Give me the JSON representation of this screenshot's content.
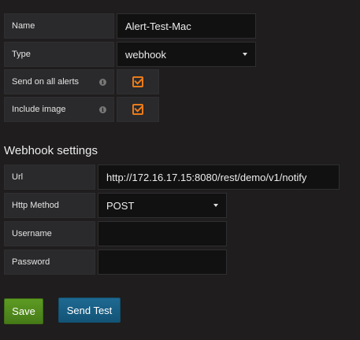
{
  "general": {
    "name_label": "Name",
    "name_value": "Alert-Test-Mac",
    "type_label": "Type",
    "type_value": "webhook",
    "send_all_label": "Send on all alerts",
    "send_all_checked": true,
    "include_image_label": "Include image",
    "include_image_checked": true,
    "info_glyph": "i"
  },
  "webhook": {
    "title": "Webhook settings",
    "url_label": "Url",
    "url_value": "http://172.16.17.15:8080/rest/demo/v1/notify",
    "method_label": "Http Method",
    "method_value": "POST",
    "username_label": "Username",
    "username_value": "",
    "password_label": "Password",
    "password_value": ""
  },
  "actions": {
    "save_label": "Save",
    "test_label": "Send Test"
  },
  "colors": {
    "accent_orange": "#eb7b18",
    "save_green": "#5d9b23",
    "test_blue": "#1e6992"
  }
}
